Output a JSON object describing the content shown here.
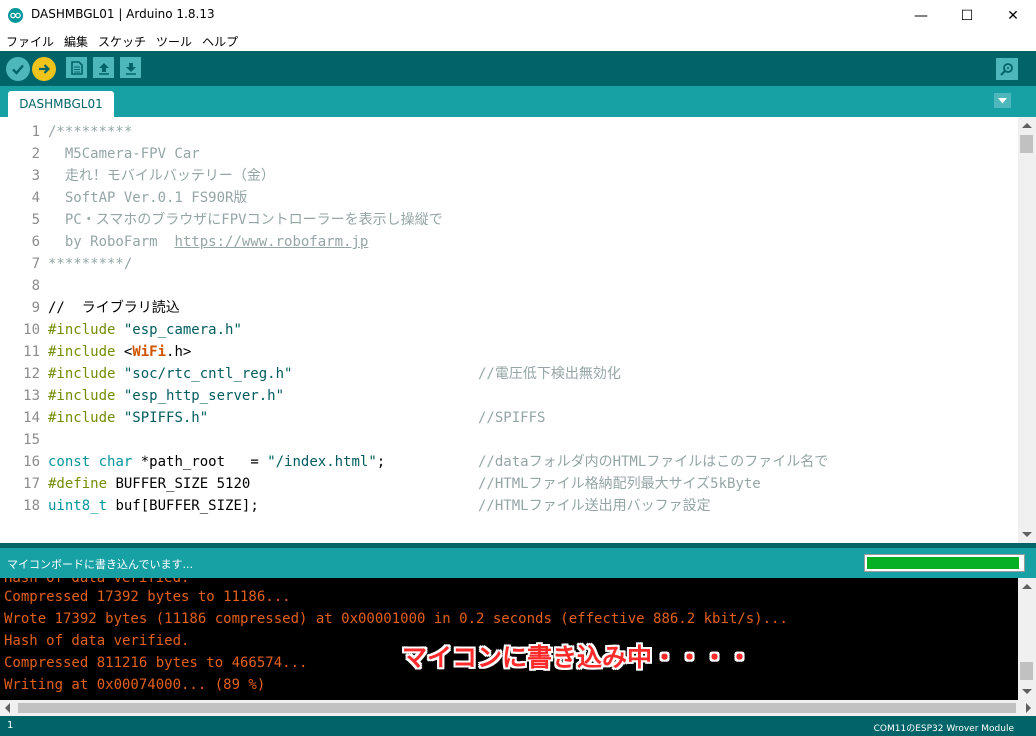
{
  "window": {
    "title": "DASHMBGL01 | Arduino 1.8.13",
    "minimize_glyph": "—",
    "maximize_glyph": "☐",
    "close_glyph": "✕"
  },
  "menu": [
    "ファイル",
    "編集",
    "スケッチ",
    "ツール",
    "ヘルプ"
  ],
  "toolbar": {
    "icons": [
      "verify-icon",
      "upload-icon",
      "new-icon",
      "open-icon",
      "save-icon",
      "serial-monitor-icon"
    ]
  },
  "tab": {
    "label": "DASHMBGL01"
  },
  "editor": {
    "line_numbers": [
      "1",
      "2",
      "3",
      "4",
      "5",
      "6",
      "7",
      "8",
      "9",
      "10",
      "11",
      "12",
      "13",
      "14",
      "15",
      "16",
      "17",
      "18"
    ],
    "l1": "/*********",
    "l2": "  M5Camera-FPV Car",
    "l3": "  走れ！モバイルバッテリー（金）",
    "l4": "  SoftAP Ver.0.1 FS90R版",
    "l5": "  PC・スマホのブラウザにFPVコントローラーを表示し操縦で",
    "l6_prefix": "  by RoboFarm  ",
    "l6_url": "https://www.robofarm.jp",
    "l7": "*********/",
    "l9": "//  ライブラリ読込",
    "inc": "#include",
    "l10_arg": "\"esp_camera.h\"",
    "l11_lt": "<",
    "l11_wifi": "WiFi",
    "l11_rest": ".h>",
    "l12_arg": "\"soc/rtc_cntl_reg.h\"",
    "l12_cmt": "//電圧低下検出無効化",
    "l13_arg": "\"esp_http_server.h\"",
    "l14_arg": "\"SPIFFS.h\"",
    "l14_cmt": "//SPIFFS",
    "l16_const": "const",
    "l16_char": "char",
    "l16_rest": "*path_root   = ",
    "l16_str": "\"/index.html\"",
    "l16_semi": ";",
    "l16_cmt": "//dataフォルダ内のHTMLファイルはこのファイル名で",
    "l17_define": "#define",
    "l17_rest": "BUFFER_SIZE 5120",
    "l17_cmt": "//HTMLファイル格納配列最大サイズ5kByte",
    "l18_type": "uint8_t",
    "l18_rest": "buf[BUFFER_SIZE];",
    "l18_cmt": "//HTMLファイル送出用バッファ設定"
  },
  "status": {
    "text": "マイコンボードに書き込んでいます...",
    "progress": 0.98,
    "progress_color": "#06b025"
  },
  "console": {
    "lines": [
      "Hash of data verified.",
      "Compressed 17392 bytes to 11186...",
      "Wrote 17392 bytes (11186 compressed) at 0x00001000 in 0.2 seconds (effective 886.2 kbit/s)...",
      "Hash of data verified.",
      "Compressed 811216 bytes to 466574...",
      "Writing at 0x00074000... (89 %)"
    ],
    "overlay": "マイコンに書き込み中・・・・",
    "text_color": "#e3601b"
  },
  "bottom": {
    "line": "1",
    "board": "COM11のESP32 Wrover Module"
  },
  "colors": {
    "teal_dark": "#006468",
    "teal": "#17a1a5",
    "teal_light": "#4db7bb",
    "upload_yellow": "#f0c41b"
  }
}
